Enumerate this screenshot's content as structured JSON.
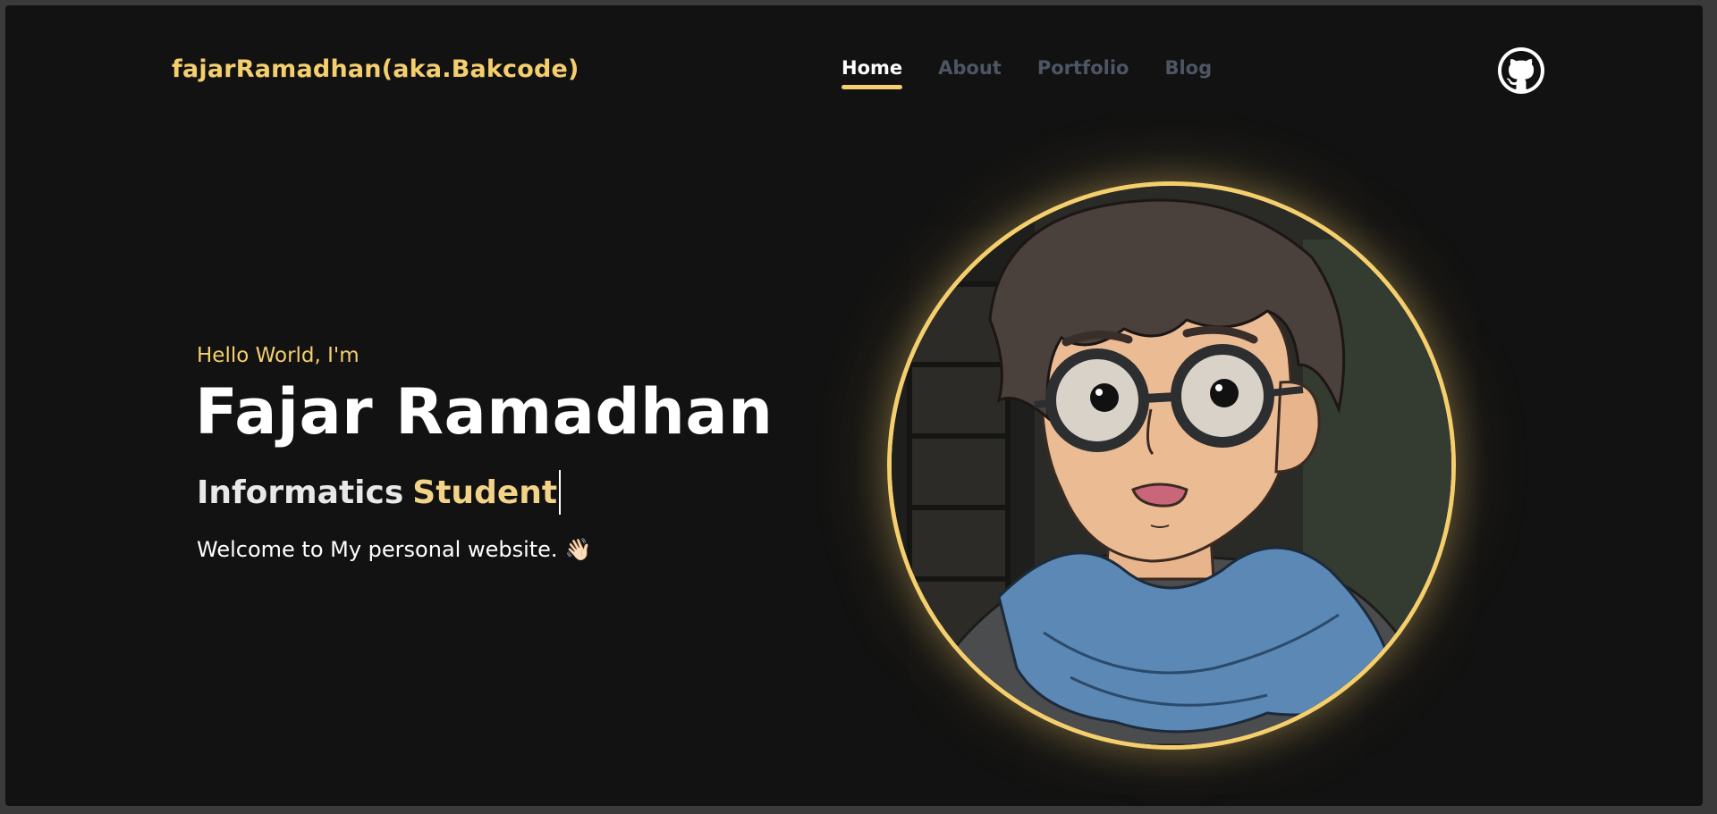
{
  "header": {
    "brand": "fajarRamadhan(aka.Bakcode)",
    "nav": [
      {
        "label": "Home",
        "active": true
      },
      {
        "label": "About",
        "active": false
      },
      {
        "label": "Portfolio",
        "active": false
      },
      {
        "label": "Blog",
        "active": false
      }
    ],
    "github_icon": "github-icon"
  },
  "hero": {
    "greeting": "Hello World, I'm",
    "name": "Fajar Ramadhan",
    "role_word1": "Informatics",
    "role_word2": "Student",
    "welcome": "Welcome to My personal website.",
    "wave_emoji": "👋🏻"
  },
  "colors": {
    "background": "#121212",
    "accent": "#f5cf6e",
    "nav_inactive": "#4e5563",
    "text": "#ffffff"
  }
}
